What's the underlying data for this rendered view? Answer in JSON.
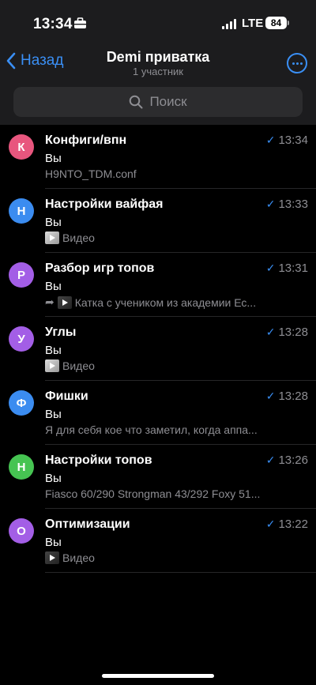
{
  "status": {
    "time": "13:34",
    "network": "LTE",
    "battery": "84"
  },
  "nav": {
    "back_label": "Назад",
    "title": "Demi приватка",
    "subtitle": "1 участник"
  },
  "search": {
    "placeholder": "Поиск"
  },
  "chats": [
    {
      "initial": "К",
      "title": "Конфиги/впн",
      "time": "13:34",
      "sender": "Вы",
      "preview": "H9NTO_TDM.conf",
      "color": "#e8567e",
      "media": "none"
    },
    {
      "initial": "Н",
      "title": "Настройки вайфая",
      "time": "13:33",
      "sender": "Вы",
      "preview": "Видео",
      "color": "#3b8cf0",
      "media": "video"
    },
    {
      "initial": "Р",
      "title": "Разбор игр топов",
      "time": "13:31",
      "sender": "Вы",
      "preview": "Катка с учеником из академии Ес...",
      "color": "#a35ee6",
      "media": "forward"
    },
    {
      "initial": "У",
      "title": "Углы",
      "time": "13:28",
      "sender": "Вы",
      "preview": "Видео",
      "color": "#a35ee6",
      "media": "video"
    },
    {
      "initial": "Ф",
      "title": "Фишки",
      "time": "13:28",
      "sender": "Вы",
      "preview": "Я для себя кое что заметил, когда аппа...",
      "color": "#3b8cf0",
      "media": "none"
    },
    {
      "initial": "Н",
      "title": "Настройки топов",
      "time": "13:26",
      "sender": "Вы",
      "preview": "Fiasco 60/290 Strongman 43/292 Foxy 51...",
      "color": "#46c452",
      "media": "none"
    },
    {
      "initial": "О",
      "title": "Оптимизации",
      "time": "13:22",
      "sender": "Вы",
      "preview": "Видео",
      "color": "#a35ee6",
      "media": "video-dark"
    }
  ],
  "colors": {
    "accent": "#3a8ff5",
    "background": "#000000",
    "header": "#1c1c1e"
  }
}
